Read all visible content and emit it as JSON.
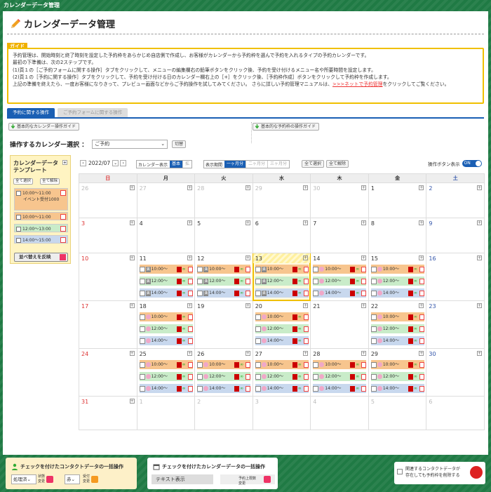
{
  "window": {
    "title": "カレンダーデータ管理"
  },
  "page": {
    "title": "カレンダーデータ管理"
  },
  "guide": {
    "tag": "ガイド",
    "lines": [
      "予約管理は、開始時刻と終了時刻を設定した予約枠をあらかじめ自店側で作成し、お客様がカレンダーから予約枠を選んで予約を入れるタイプの予約カレンダーです。",
      "最初の下準備は、次の2ステップです。",
      "(1)頁１の［ご予約フォームに関する操作］タブをクリックして、メニューの編集欄右の鉛筆ボタンをクリック後、予約を受け付けるメニュー名や所要時間を設定します。",
      "(2)頁１の［予約に関する操作］タブをクリックして、予約を受け付ける日のカレンダー欄右上の［+］をクリック後、［予約枠作成］ボタンをクリックして予約枠を作成します。"
    ],
    "last_before": "上記の準備を終えたら、一度お客様になりきって、プレビュー画面などからご予約操作を試してみてください。 さらに詳しい予約管理マニュアルは、",
    "last_link": ">>>ネットで予約管理",
    "last_after": "をクリックしてご覧ください。"
  },
  "tabs": {
    "reservation": "予約に関する操作",
    "form": "ご予約フォームに関する操作"
  },
  "guides": {
    "basic": "基本的なカレンダー操作ガイド",
    "slot": "基本的な予約枠の操作ガイド"
  },
  "calendar_select": {
    "label": "操作するカレンダー選択 ：",
    "value": "ご予約",
    "switch": "切替"
  },
  "template": {
    "title": "カレンダーデータ\nテンプレート",
    "select_all": "全て選択",
    "deselect_all": "全て解除",
    "items": [
      {
        "time": "10:00〜11:00",
        "note": "イベント受付1000",
        "color": "#f7c58e"
      },
      {
        "time": "10:00〜11:00",
        "note": "",
        "color": "#f7c58e"
      },
      {
        "time": "12:00〜13:00",
        "note": "",
        "color": "#c9ecc9"
      },
      {
        "time": "14:00〜15:00",
        "note": "",
        "color": "#c8d8ee"
      }
    ],
    "apply": "並べ替えを反映"
  },
  "controls": {
    "month": "2022/07",
    "cal_display_label": "カレンダー表示",
    "cal_basic": "基本",
    "cal_wide": "拡",
    "period_label": "表示期間",
    "period_1": "一ヶ月分",
    "period_2": "二ヶ月分",
    "period_3": "三ヶ月分",
    "select_all": "全て選択",
    "deselect_all": "全て解除",
    "op_button_label": "操作ボタン表示",
    "toggle": "ON"
  },
  "weekdays": [
    "日",
    "月",
    "火",
    "水",
    "木",
    "金",
    "土"
  ],
  "weeks": [
    [
      {
        "d": "26",
        "gray": true
      },
      {
        "d": "27",
        "gray": true
      },
      {
        "d": "28",
        "gray": true
      },
      {
        "d": "29",
        "gray": true
      },
      {
        "d": "30",
        "gray": true
      },
      {
        "d": "1"
      },
      {
        "d": "2"
      }
    ],
    [
      {
        "d": "3"
      },
      {
        "d": "4"
      },
      {
        "d": "5"
      },
      {
        "d": "6"
      },
      {
        "d": "7"
      },
      {
        "d": "8"
      },
      {
        "d": "9"
      }
    ],
    [
      {
        "d": "10"
      },
      {
        "d": "11",
        "slots": "lock"
      },
      {
        "d": "12",
        "slots": "lock"
      },
      {
        "d": "13",
        "slots": "lock",
        "today": true
      },
      {
        "d": "14",
        "slots": "pink"
      },
      {
        "d": "15",
        "slots": "pink"
      },
      {
        "d": "16"
      }
    ],
    [
      {
        "d": "17"
      },
      {
        "d": "18",
        "slots": "pink"
      },
      {
        "d": "19"
      },
      {
        "d": "20",
        "slots": "pink"
      },
      {
        "d": "21"
      },
      {
        "d": "22",
        "slots": "pink"
      },
      {
        "d": "23"
      }
    ],
    [
      {
        "d": "24"
      },
      {
        "d": "25",
        "slots": "pink"
      },
      {
        "d": "26",
        "slots": "pink"
      },
      {
        "d": "27",
        "slots": "pink"
      },
      {
        "d": "28",
        "slots": "pink"
      },
      {
        "d": "29",
        "slots": "pink"
      },
      {
        "d": "30"
      }
    ],
    [
      {
        "d": "31"
      },
      {
        "d": "1",
        "gray": true
      },
      {
        "d": "2",
        "gray": true
      },
      {
        "d": "3",
        "gray": true
      },
      {
        "d": "4",
        "gray": true
      },
      {
        "d": "5",
        "gray": true
      },
      {
        "d": "6",
        "gray": true
      }
    ]
  ],
  "slot_labels": [
    "10:00〜",
    "12:00〜",
    "14:00〜"
  ],
  "lock_label": "満",
  "bottom": {
    "contact": {
      "title": "チェックを付けたコンタクトデータの一括操作",
      "sel1": "処理済",
      "small1": "状態\n変更",
      "sel2": "赤",
      "small2": "受付\n変更"
    },
    "calendar": {
      "title": "チェックを付けたカレンダーデータの一括操作",
      "text_display": "テキスト表示",
      "small": "予約上限数\n変更"
    },
    "delete": {
      "label": "関連するコンタクトデータが\n存在しても予約枠を削除する"
    }
  },
  "colors": {
    "accent": "#1a5fb4",
    "frame": "#1f7a44",
    "guide_border": "#f0c000"
  }
}
